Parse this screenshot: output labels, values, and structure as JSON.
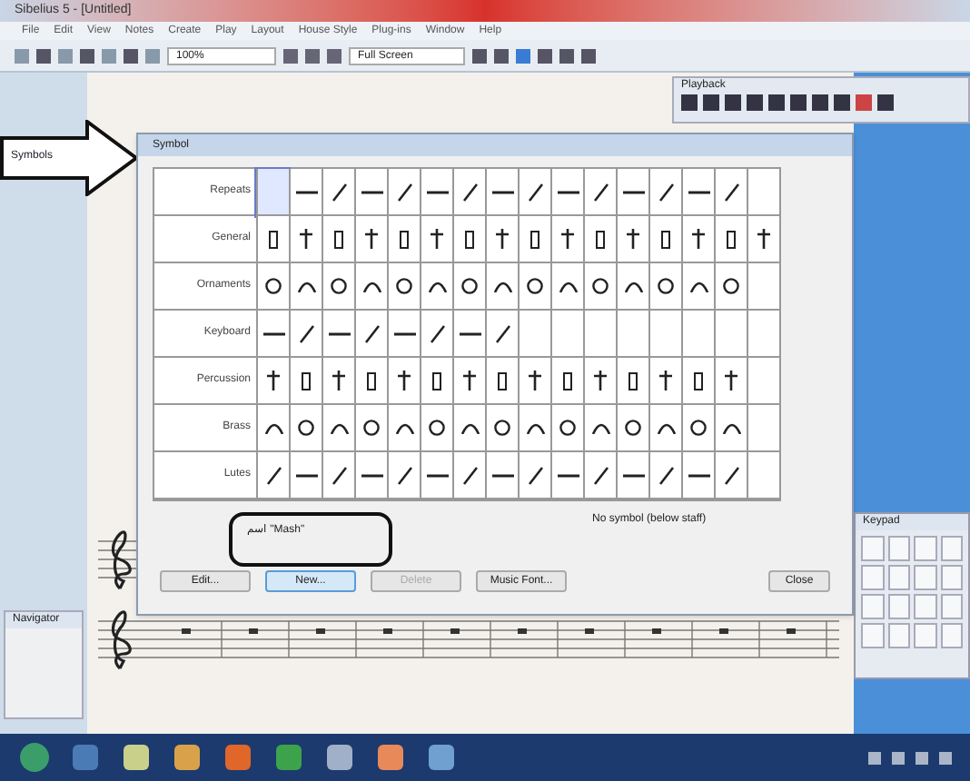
{
  "window": {
    "title": "Sibelius 5 - [Untitled]"
  },
  "menu": [
    "File",
    "Edit",
    "View",
    "Notes",
    "Create",
    "Play",
    "Layout",
    "House Style",
    "Plug-ins",
    "Window",
    "Help"
  ],
  "toolbar": {
    "zoom": "100%",
    "view": "Full Screen"
  },
  "playback": {
    "title": "Playback"
  },
  "callout_arrow": {
    "label": "Symbols"
  },
  "dialog": {
    "title": "Symbol",
    "rows": [
      {
        "label": "Repeats",
        "cells": [
          {
            "kind": "blank",
            "selected": true
          },
          {
            "kind": "symbol",
            "selected": false
          },
          {
            "kind": "symbol",
            "selected": false
          },
          {
            "kind": "symbol",
            "selected": false
          },
          {
            "kind": "symbol",
            "selected": false
          },
          {
            "kind": "symbol",
            "selected": false
          },
          {
            "kind": "symbol",
            "selected": false
          },
          {
            "kind": "symbol",
            "selected": false
          },
          {
            "kind": "symbol",
            "selected": false
          },
          {
            "kind": "symbol",
            "selected": false
          },
          {
            "kind": "symbol",
            "selected": false
          },
          {
            "kind": "symbol",
            "selected": false
          },
          {
            "kind": "symbol",
            "selected": false
          },
          {
            "kind": "symbol",
            "selected": false
          },
          {
            "kind": "symbol",
            "selected": false
          },
          {
            "kind": "blank",
            "selected": false
          }
        ]
      },
      {
        "label": "General",
        "cells": [
          {
            "kind": "symbol",
            "selected": false
          },
          {
            "kind": "symbol",
            "selected": false
          },
          {
            "kind": "symbol",
            "selected": false
          },
          {
            "kind": "symbol",
            "selected": false
          },
          {
            "kind": "symbol",
            "selected": false
          },
          {
            "kind": "symbol",
            "selected": false
          },
          {
            "kind": "symbol",
            "selected": false
          },
          {
            "kind": "symbol",
            "selected": false
          },
          {
            "kind": "symbol",
            "selected": false
          },
          {
            "kind": "symbol",
            "selected": false
          },
          {
            "kind": "symbol",
            "selected": false
          },
          {
            "kind": "symbol",
            "selected": false
          },
          {
            "kind": "symbol",
            "selected": false
          },
          {
            "kind": "symbol",
            "selected": false
          },
          {
            "kind": "symbol",
            "selected": false
          },
          {
            "kind": "symbol",
            "selected": false
          }
        ]
      },
      {
        "label": "Ornaments",
        "cells": [
          {
            "kind": "symbol",
            "selected": false
          },
          {
            "kind": "symbol",
            "selected": false
          },
          {
            "kind": "symbol",
            "selected": false
          },
          {
            "kind": "symbol",
            "selected": false
          },
          {
            "kind": "symbol",
            "selected": false
          },
          {
            "kind": "symbol",
            "selected": false
          },
          {
            "kind": "symbol",
            "selected": false
          },
          {
            "kind": "symbol",
            "selected": false
          },
          {
            "kind": "symbol",
            "selected": false
          },
          {
            "kind": "symbol",
            "selected": false
          },
          {
            "kind": "symbol",
            "selected": false
          },
          {
            "kind": "symbol",
            "selected": false
          },
          {
            "kind": "symbol",
            "selected": false
          },
          {
            "kind": "symbol",
            "selected": false
          },
          {
            "kind": "symbol",
            "selected": false
          },
          {
            "kind": "blank",
            "selected": false
          }
        ]
      },
      {
        "label": "Keyboard",
        "cells": [
          {
            "kind": "symbol",
            "selected": false
          },
          {
            "kind": "symbol",
            "selected": false
          },
          {
            "kind": "symbol",
            "selected": false
          },
          {
            "kind": "symbol",
            "selected": false
          },
          {
            "kind": "symbol",
            "selected": false
          },
          {
            "kind": "symbol",
            "selected": false
          },
          {
            "kind": "symbol",
            "selected": false
          },
          {
            "kind": "symbol",
            "selected": false
          },
          {
            "kind": "blank",
            "selected": false
          },
          {
            "kind": "blank",
            "selected": false
          },
          {
            "kind": "blank",
            "selected": false
          },
          {
            "kind": "blank",
            "selected": false
          },
          {
            "kind": "blank",
            "selected": false
          },
          {
            "kind": "blank",
            "selected": false
          },
          {
            "kind": "blank",
            "selected": false
          },
          {
            "kind": "blank",
            "selected": false
          }
        ]
      },
      {
        "label": "Percussion",
        "cells": [
          {
            "kind": "symbol",
            "selected": false
          },
          {
            "kind": "symbol",
            "selected": false
          },
          {
            "kind": "symbol",
            "selected": false
          },
          {
            "kind": "symbol",
            "selected": false
          },
          {
            "kind": "symbol",
            "selected": false
          },
          {
            "kind": "symbol",
            "selected": false
          },
          {
            "kind": "symbol",
            "selected": false
          },
          {
            "kind": "symbol",
            "selected": false
          },
          {
            "kind": "symbol",
            "selected": false
          },
          {
            "kind": "symbol",
            "selected": false
          },
          {
            "kind": "symbol",
            "selected": false
          },
          {
            "kind": "symbol",
            "selected": false
          },
          {
            "kind": "symbol",
            "selected": false
          },
          {
            "kind": "symbol",
            "selected": false
          },
          {
            "kind": "symbol",
            "selected": false
          },
          {
            "kind": "blank",
            "selected": false
          }
        ]
      },
      {
        "label": "Brass",
        "cells": [
          {
            "kind": "symbol",
            "selected": false
          },
          {
            "kind": "symbol",
            "selected": false
          },
          {
            "kind": "symbol",
            "selected": false
          },
          {
            "kind": "symbol",
            "selected": false
          },
          {
            "kind": "symbol",
            "selected": false
          },
          {
            "kind": "symbol",
            "selected": false
          },
          {
            "kind": "symbol",
            "selected": false
          },
          {
            "kind": "symbol",
            "selected": false
          },
          {
            "kind": "symbol",
            "selected": false
          },
          {
            "kind": "symbol",
            "selected": false
          },
          {
            "kind": "symbol",
            "selected": false
          },
          {
            "kind": "symbol",
            "selected": false
          },
          {
            "kind": "symbol",
            "selected": false
          },
          {
            "kind": "symbol",
            "selected": false
          },
          {
            "kind": "symbol",
            "selected": false
          },
          {
            "kind": "blank",
            "selected": false
          }
        ]
      },
      {
        "label": "Lutes",
        "cells": [
          {
            "kind": "symbol",
            "selected": false
          },
          {
            "kind": "symbol",
            "selected": false
          },
          {
            "kind": "symbol",
            "selected": false
          },
          {
            "kind": "symbol",
            "selected": false
          },
          {
            "kind": "symbol",
            "selected": false
          },
          {
            "kind": "symbol",
            "selected": false
          },
          {
            "kind": "symbol",
            "selected": false
          },
          {
            "kind": "symbol",
            "selected": false
          },
          {
            "kind": "symbol",
            "selected": false
          },
          {
            "kind": "symbol",
            "selected": false
          },
          {
            "kind": "symbol",
            "selected": false
          },
          {
            "kind": "symbol",
            "selected": false
          },
          {
            "kind": "symbol",
            "selected": false
          },
          {
            "kind": "symbol",
            "selected": false
          },
          {
            "kind": "symbol",
            "selected": false
          },
          {
            "kind": "blank",
            "selected": false
          }
        ]
      }
    ],
    "callout_text": "اسم \"Mash\"",
    "status": "No symbol (below staff)",
    "buttons": [
      {
        "label": "Edit...",
        "disabled": false,
        "selected": false
      },
      {
        "label": "New...",
        "disabled": false,
        "selected": true
      },
      {
        "label": "Delete",
        "disabled": true,
        "selected": false
      },
      {
        "label": "Music Font...",
        "disabled": false,
        "selected": false
      }
    ],
    "close_button": "Close"
  },
  "navigator": {
    "title": "Navigator"
  },
  "keypad": {
    "title": "Keypad"
  }
}
